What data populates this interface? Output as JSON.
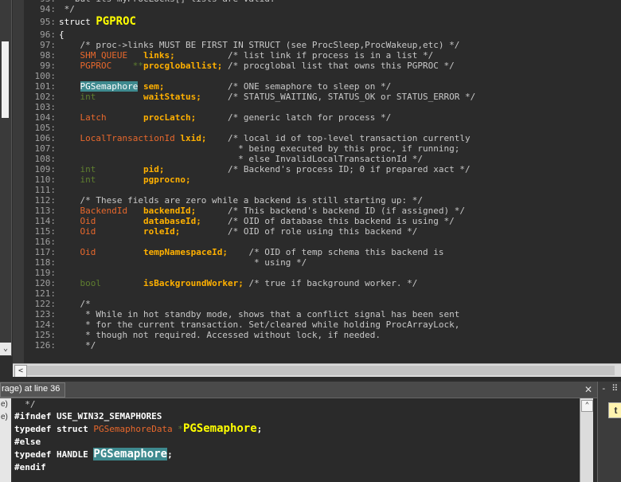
{
  "editor": {
    "lines": [
      {
        "n": "93:",
        "parts": [
          {
            "t": " * but its myProcLocks[] lists are valid.",
            "c": "cmt"
          }
        ]
      },
      {
        "n": "94:",
        "parts": [
          {
            "t": " */",
            "c": "cmt"
          }
        ]
      },
      {
        "n": "95:",
        "big": true,
        "parts": [
          {
            "t": "struct ",
            "c": "kw"
          },
          {
            "t": "PGPROC",
            "c": "big"
          }
        ]
      },
      {
        "n": "96:",
        "parts": [
          {
            "t": "{",
            "c": "kw"
          }
        ]
      },
      {
        "n": "97:",
        "parts": [
          {
            "t": "    /* proc->links MUST BE FIRST IN STRUCT (see ProcSleep,ProcWakeup,etc) */",
            "c": "cmt"
          }
        ]
      },
      {
        "n": "98:",
        "parts": [
          {
            "t": "    ",
            "c": ""
          },
          {
            "t": "SHM_QUEUE",
            "c": "type"
          },
          {
            "t": "   ",
            "c": ""
          },
          {
            "t": "links;",
            "c": "ident"
          },
          {
            "t": "          /* list link if process is in a list */",
            "c": "cmt"
          }
        ]
      },
      {
        "n": "99:",
        "parts": [
          {
            "t": "    ",
            "c": ""
          },
          {
            "t": "PGPROC",
            "c": "type"
          },
          {
            "t": "    **",
            "c": "int"
          },
          {
            "t": "procgloballist;",
            "c": "ident"
          },
          {
            "t": " /* procglobal list that owns this PGPROC */",
            "c": "cmt"
          }
        ]
      },
      {
        "n": "100:",
        "parts": []
      },
      {
        "n": "101:",
        "parts": [
          {
            "t": "    ",
            "c": ""
          },
          {
            "t": "PGSemaphore",
            "c": "hl"
          },
          {
            "t": " ",
            "c": ""
          },
          {
            "t": "sem;",
            "c": "ident"
          },
          {
            "t": "            /* ONE semaphore to sleep on */",
            "c": "cmt"
          }
        ]
      },
      {
        "n": "102:",
        "parts": [
          {
            "t": "    ",
            "c": ""
          },
          {
            "t": "int",
            "c": "int"
          },
          {
            "t": "         ",
            "c": ""
          },
          {
            "t": "waitStatus;",
            "c": "ident"
          },
          {
            "t": "     /* STATUS_WAITING, STATUS_OK or STATUS_ERROR */",
            "c": "cmt"
          }
        ]
      },
      {
        "n": "103:",
        "parts": []
      },
      {
        "n": "104:",
        "parts": [
          {
            "t": "    ",
            "c": ""
          },
          {
            "t": "Latch",
            "c": "type"
          },
          {
            "t": "       ",
            "c": ""
          },
          {
            "t": "procLatch;",
            "c": "ident"
          },
          {
            "t": "      /* generic latch for process */",
            "c": "cmt"
          }
        ]
      },
      {
        "n": "105:",
        "parts": []
      },
      {
        "n": "106:",
        "parts": [
          {
            "t": "    ",
            "c": ""
          },
          {
            "t": "LocalTransactionId",
            "c": "type"
          },
          {
            "t": " ",
            "c": ""
          },
          {
            "t": "lxid;",
            "c": "ident"
          },
          {
            "t": "    /* local id of top-level transaction currently",
            "c": "cmt"
          }
        ]
      },
      {
        "n": "107:",
        "parts": [
          {
            "t": "                                  * being executed by this proc, if running;",
            "c": "cmt"
          }
        ]
      },
      {
        "n": "108:",
        "parts": [
          {
            "t": "                                  * else InvalidLocalTransactionId */",
            "c": "cmt"
          }
        ]
      },
      {
        "n": "109:",
        "parts": [
          {
            "t": "    ",
            "c": ""
          },
          {
            "t": "int",
            "c": "int"
          },
          {
            "t": "         ",
            "c": ""
          },
          {
            "t": "pid;",
            "c": "ident"
          },
          {
            "t": "            /* Backend's process ID; 0 if prepared xact */",
            "c": "cmt"
          }
        ]
      },
      {
        "n": "110:",
        "parts": [
          {
            "t": "    ",
            "c": ""
          },
          {
            "t": "int",
            "c": "int"
          },
          {
            "t": "         ",
            "c": ""
          },
          {
            "t": "pgprocno;",
            "c": "ident"
          }
        ]
      },
      {
        "n": "111:",
        "parts": []
      },
      {
        "n": "112:",
        "parts": [
          {
            "t": "    /* These fields are zero while a backend is still starting up: */",
            "c": "cmt"
          }
        ]
      },
      {
        "n": "113:",
        "parts": [
          {
            "t": "    ",
            "c": ""
          },
          {
            "t": "BackendId",
            "c": "type"
          },
          {
            "t": "   ",
            "c": ""
          },
          {
            "t": "backendId;",
            "c": "ident"
          },
          {
            "t": "      /* This backend's backend ID (if assigned) */",
            "c": "cmt"
          }
        ]
      },
      {
        "n": "114:",
        "parts": [
          {
            "t": "    ",
            "c": ""
          },
          {
            "t": "Oid",
            "c": "type"
          },
          {
            "t": "         ",
            "c": ""
          },
          {
            "t": "databaseId;",
            "c": "ident"
          },
          {
            "t": "     /* OID of database this backend is using */",
            "c": "cmt"
          }
        ]
      },
      {
        "n": "115:",
        "parts": [
          {
            "t": "    ",
            "c": ""
          },
          {
            "t": "Oid",
            "c": "type"
          },
          {
            "t": "         ",
            "c": ""
          },
          {
            "t": "roleId;",
            "c": "ident"
          },
          {
            "t": "         /* OID of role using this backend */",
            "c": "cmt"
          }
        ]
      },
      {
        "n": "116:",
        "parts": []
      },
      {
        "n": "117:",
        "parts": [
          {
            "t": "    ",
            "c": ""
          },
          {
            "t": "Oid",
            "c": "type"
          },
          {
            "t": "         ",
            "c": ""
          },
          {
            "t": "tempNamespaceId;",
            "c": "ident"
          },
          {
            "t": "    /* OID of temp schema this backend is",
            "c": "cmt"
          }
        ]
      },
      {
        "n": "118:",
        "parts": [
          {
            "t": "                                     * using */",
            "c": "cmt"
          }
        ]
      },
      {
        "n": "119:",
        "parts": []
      },
      {
        "n": "120:",
        "parts": [
          {
            "t": "    ",
            "c": ""
          },
          {
            "t": "bool",
            "c": "int"
          },
          {
            "t": "        ",
            "c": ""
          },
          {
            "t": "isBackgroundWorker;",
            "c": "ident"
          },
          {
            "t": " /* true if background worker. */",
            "c": "cmt"
          }
        ]
      },
      {
        "n": "121:",
        "parts": []
      },
      {
        "n": "122:",
        "parts": [
          {
            "t": "    /*",
            "c": "cmt"
          }
        ]
      },
      {
        "n": "123:",
        "parts": [
          {
            "t": "     * While in hot standby mode, shows that a conflict signal has been sent",
            "c": "cmt"
          }
        ]
      },
      {
        "n": "124:",
        "parts": [
          {
            "t": "     * for the current transaction. Set/cleared while holding ProcArrayLock,",
            "c": "cmt"
          }
        ]
      },
      {
        "n": "125:",
        "parts": [
          {
            "t": "     * though not required. Accessed without lock, if needed.",
            "c": "cmt"
          }
        ]
      },
      {
        "n": "126:",
        "parts": [
          {
            "t": "     */",
            "c": "cmt"
          }
        ]
      }
    ]
  },
  "left_strip": {
    "arrow": "⌄"
  },
  "hscroll": {
    "left_arrow": "<"
  },
  "bottom": {
    "tab_label": "rage) at line 36",
    "close_label": "✕",
    "right_header": "- ⠿",
    "right_button": "t",
    "left_labels": [
      "e)",
      "e)"
    ],
    "scroll_up": "⌃",
    "lines": [
      {
        "tall": false,
        "parts": [
          {
            "t": "  */",
            "c": "cmt"
          }
        ]
      },
      {
        "tall": false,
        "parts": [
          {
            "t": "#ifndef USE_WIN32_SEMAPHORES",
            "c": "pp"
          }
        ]
      },
      {
        "tall": true,
        "parts": [
          {
            "t": "typedef struct ",
            "c": "pp"
          },
          {
            "t": "PGSemaphoreData",
            "c": "type"
          },
          {
            "t": " *",
            "c": "int"
          },
          {
            "t": "PGSemaphore",
            "c": "bbig"
          },
          {
            "t": ";",
            "c": "pp"
          }
        ]
      },
      {
        "tall": false,
        "parts": [
          {
            "t": "#else",
            "c": "pp"
          }
        ]
      },
      {
        "tall": true,
        "parts": [
          {
            "t": "typedef HANDLE ",
            "c": "pp"
          },
          {
            "t": "PGSemaphore",
            "c": "bbig hl"
          },
          {
            "t": ";",
            "c": "pp"
          }
        ]
      },
      {
        "tall": false,
        "parts": [
          {
            "t": "#endif",
            "c": "pp"
          }
        ]
      }
    ]
  }
}
